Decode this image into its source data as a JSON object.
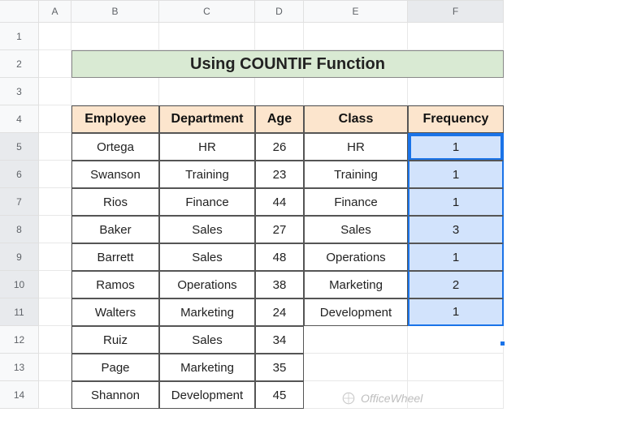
{
  "columns": [
    "A",
    "B",
    "C",
    "D",
    "E",
    "F"
  ],
  "rows": [
    "1",
    "2",
    "3",
    "4",
    "5",
    "6",
    "7",
    "8",
    "9",
    "10",
    "11",
    "12",
    "13",
    "14"
  ],
  "title": "Using COUNTIF Function",
  "headers": {
    "employee": "Employee",
    "department": "Department",
    "age": "Age",
    "class": "Class",
    "frequency": "Frequency"
  },
  "data": [
    {
      "employee": "Ortega",
      "department": "HR",
      "age": "26",
      "class": "HR",
      "frequency": "1"
    },
    {
      "employee": "Swanson",
      "department": "Training",
      "age": "23",
      "class": "Training",
      "frequency": "1"
    },
    {
      "employee": "Rios",
      "department": "Finance",
      "age": "44",
      "class": "Finance",
      "frequency": "1"
    },
    {
      "employee": "Baker",
      "department": "Sales",
      "age": "27",
      "class": "Sales",
      "frequency": "3"
    },
    {
      "employee": "Barrett",
      "department": "Sales",
      "age": "48",
      "class": "Operations",
      "frequency": "1"
    },
    {
      "employee": "Ramos",
      "department": "Operations",
      "age": "38",
      "class": "Marketing",
      "frequency": "2"
    },
    {
      "employee": "Walters",
      "department": "Marketing",
      "age": "24",
      "class": "Development",
      "frequency": "1"
    },
    {
      "employee": "Ruiz",
      "department": "Sales",
      "age": "34",
      "class": "",
      "frequency": ""
    },
    {
      "employee": "Page",
      "department": "Marketing",
      "age": "35",
      "class": "",
      "frequency": ""
    },
    {
      "employee": "Shannon",
      "department": "Development",
      "age": "45",
      "class": "",
      "frequency": ""
    }
  ],
  "watermark": "OfficeWheel",
  "chart_data": {
    "type": "table",
    "title": "Using COUNTIF Function",
    "columns": [
      "Employee",
      "Department",
      "Age",
      "Class",
      "Frequency"
    ],
    "rows": [
      [
        "Ortega",
        "HR",
        26,
        "HR",
        1
      ],
      [
        "Swanson",
        "Training",
        23,
        "Training",
        1
      ],
      [
        "Rios",
        "Finance",
        44,
        "Finance",
        1
      ],
      [
        "Baker",
        "Sales",
        27,
        "Sales",
        3
      ],
      [
        "Barrett",
        "Sales",
        48,
        "Operations",
        1
      ],
      [
        "Ramos",
        "Operations",
        38,
        "Marketing",
        2
      ],
      [
        "Walters",
        "Marketing",
        24,
        "Development",
        1
      ],
      [
        "Ruiz",
        "Sales",
        34,
        null,
        null
      ],
      [
        "Page",
        "Marketing",
        35,
        null,
        null
      ],
      [
        "Shannon",
        "Development",
        45,
        null,
        null
      ]
    ]
  }
}
